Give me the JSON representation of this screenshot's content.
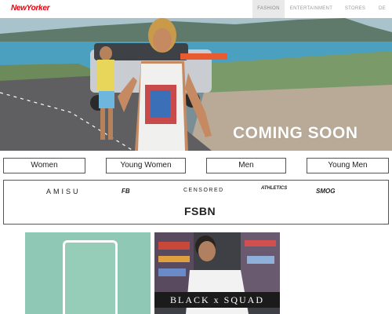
{
  "header": {
    "logo": "NewYorker",
    "nav": [
      {
        "label": "FASHION",
        "active": true
      },
      {
        "label": "ENTERTAINMENT",
        "active": false
      },
      {
        "label": "STORES",
        "active": false
      },
      {
        "label": "DE",
        "active": false
      }
    ]
  },
  "hero": {
    "title": "COMING SOON",
    "slide_count": 4,
    "active_slide": 1
  },
  "categories": [
    "Women",
    "Young Women",
    "Men",
    "Young Men"
  ],
  "brands": {
    "amisu": "AMISU",
    "fb": "FB",
    "censored": "CENSORED",
    "athletics": "ATHLETICS",
    "smog": "SMOG",
    "fsbn": "FSBN"
  },
  "promos": {
    "black_squad": "BLACK x SQUAD"
  },
  "colors": {
    "brand_red": "#e0000b",
    "nav_active_bg": "#e9e9e9",
    "promo_mint": "#8fc8b4"
  }
}
